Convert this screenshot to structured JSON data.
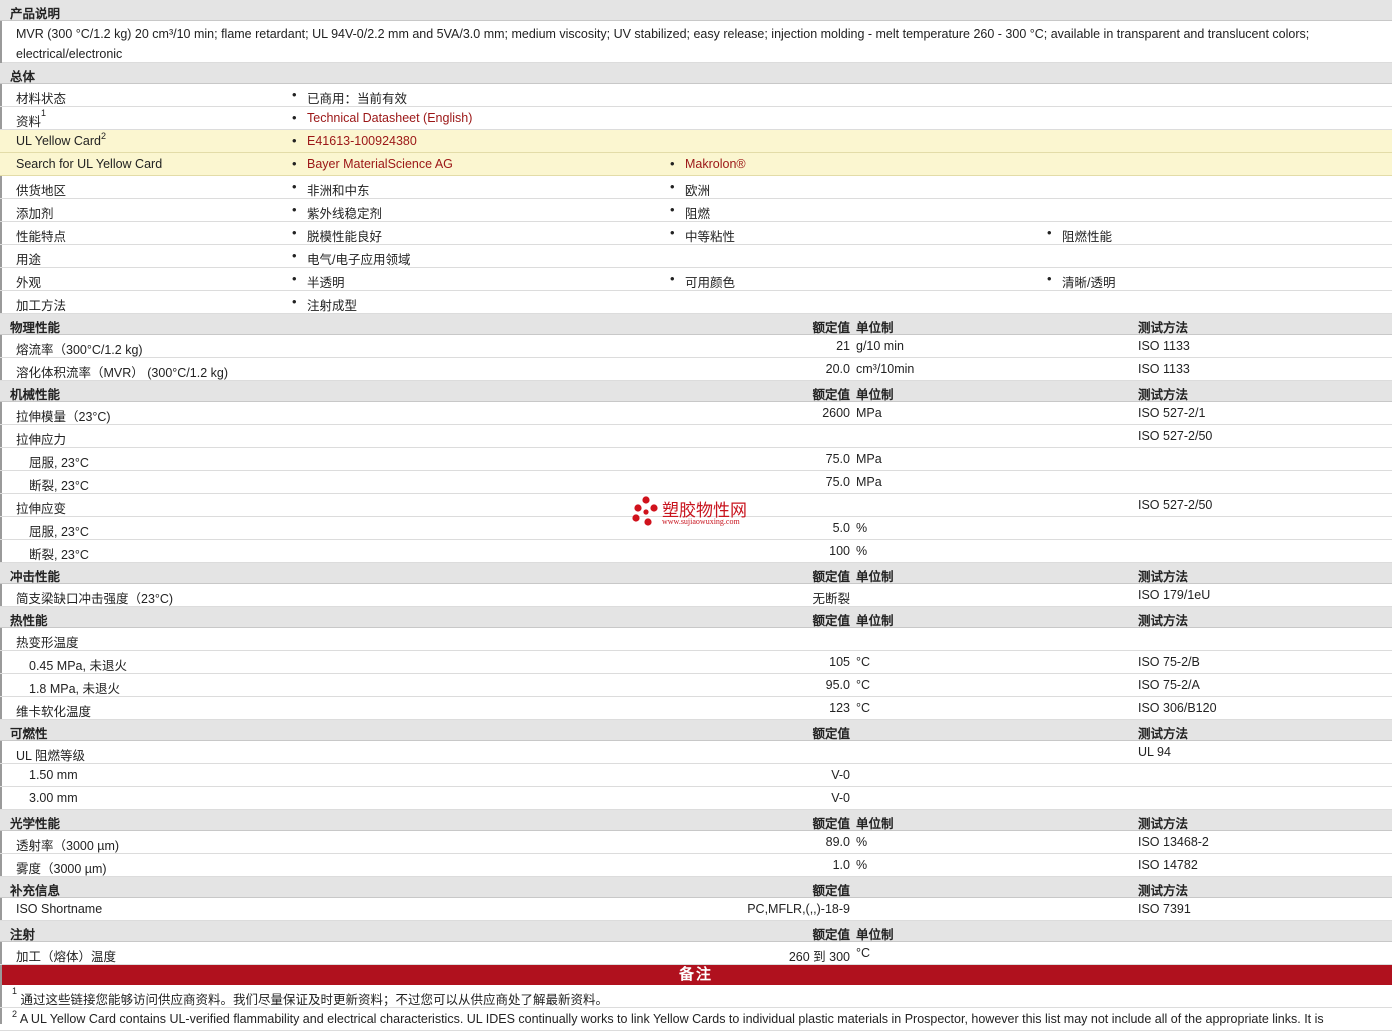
{
  "description": {
    "header": "产品说明",
    "text": "MVR (300 °C/1.2 kg) 20 cm³/10 min; flame retardant; UL 94V-0/2.2 mm and 5VA/3.0 mm; medium viscosity; UV stabilized; easy release; injection molding - melt temperature 260 - 300 °C; available in transparent and translucent colors; electrical/electronic"
  },
  "general": {
    "header": "总体",
    "rows": [
      {
        "label": "材料状态",
        "items": [
          "已商用：当前有效"
        ]
      },
      {
        "label": "资料",
        "sup": "1",
        "items": [
          "Technical Datasheet (English)"
        ],
        "link": true
      },
      {
        "label": "UL Yellow Card",
        "sup": "2",
        "items": [
          "E41613-100924380"
        ],
        "link": true,
        "yellow": true
      },
      {
        "label": "Search for UL Yellow Card",
        "items": [
          "Bayer MaterialScience AG",
          "Makrolon®"
        ],
        "link": true,
        "yellow": true
      },
      {
        "label": "供货地区",
        "items": [
          "非洲和中东",
          "欧洲"
        ]
      },
      {
        "label": "添加剂",
        "items": [
          "紫外线稳定剂",
          "阻燃"
        ]
      },
      {
        "label": "性能特点",
        "items": [
          "脱模性能良好",
          "中等粘性",
          "阻燃性能"
        ]
      },
      {
        "label": "用途",
        "items": [
          "电气/电子应用领域"
        ]
      },
      {
        "label": "外观",
        "items": [
          "半透明",
          "可用颜色",
          "清晰/透明"
        ]
      },
      {
        "label": "加工方法",
        "items": [
          "注射成型"
        ]
      }
    ]
  },
  "cols": {
    "value": "额定值",
    "unit": "单位制",
    "test": "测试方法"
  },
  "sections": [
    {
      "title": "物理性能",
      "unit": true,
      "test": true,
      "rows": [
        {
          "label": "熔流率（300°C/1.2 kg)",
          "value": "21",
          "unit": "g/10 min",
          "test": "ISO 1133"
        },
        {
          "label": "溶化体积流率（MVR） (300°C/1.2 kg)",
          "value": "20.0",
          "unit": "cm³/10min",
          "test": "ISO 1133"
        }
      ]
    },
    {
      "title": "机械性能",
      "unit": true,
      "test": true,
      "rows": [
        {
          "label": "拉伸模量（23°C)",
          "value": "2600",
          "unit": "MPa",
          "test": "ISO 527-2/1"
        },
        {
          "label": "拉伸应力",
          "value": "",
          "unit": "",
          "test": "ISO 527-2/50"
        },
        {
          "label": "屈服, 23°C",
          "sub": true,
          "value": "75.0",
          "unit": "MPa",
          "test": ""
        },
        {
          "label": "断裂, 23°C",
          "sub": true,
          "value": "75.0",
          "unit": "MPa",
          "test": ""
        },
        {
          "label": "拉伸应变",
          "value": "",
          "unit": "",
          "test": "ISO 527-2/50"
        },
        {
          "label": "屈服, 23°C",
          "sub": true,
          "value": "5.0",
          "unit": "%",
          "test": ""
        },
        {
          "label": "断裂, 23°C",
          "sub": true,
          "value": "100",
          "unit": "%",
          "test": ""
        }
      ]
    },
    {
      "title": "冲击性能",
      "unit": true,
      "test": true,
      "rows": [
        {
          "label": "简支梁缺口冲击强度（23°C)",
          "value": "无断裂",
          "unit": "",
          "test": "ISO 179/1eU"
        }
      ]
    },
    {
      "title": "热性能",
      "unit": true,
      "test": true,
      "rows": [
        {
          "label": "热变形温度",
          "value": "",
          "unit": "",
          "test": ""
        },
        {
          "label": "0.45 MPa, 未退火",
          "sub": true,
          "value": "105",
          "unit": "°C",
          "test": "ISO 75-2/B"
        },
        {
          "label": "1.8 MPa, 未退火",
          "sub": true,
          "value": "95.0",
          "unit": "°C",
          "test": "ISO 75-2/A"
        },
        {
          "label": "维卡软化温度",
          "value": "123",
          "unit": "°C",
          "test": "ISO 306/B120"
        }
      ]
    },
    {
      "title": "可燃性",
      "unit": false,
      "test": true,
      "rows": [
        {
          "label": "UL 阻燃等级",
          "value": "",
          "unit": "",
          "test": "UL 94"
        },
        {
          "label": "1.50 mm",
          "sub": true,
          "value": "V-0",
          "unit": "",
          "test": ""
        },
        {
          "label": "3.00 mm",
          "sub": true,
          "value": "V-0",
          "unit": "",
          "test": ""
        }
      ]
    },
    {
      "title": "光学性能",
      "unit": true,
      "test": true,
      "rows": [
        {
          "label": "透射率（3000 µm)",
          "value": "89.0",
          "unit": "%",
          "test": "ISO 13468-2"
        },
        {
          "label": "雾度（3000 µm)",
          "value": "1.0",
          "unit": "%",
          "test": "ISO 14782"
        }
      ]
    },
    {
      "title": "补充信息",
      "unit": false,
      "test": true,
      "rows": [
        {
          "label": "ISO Shortname",
          "value": "PC,MFLR,(,,)-18-9",
          "unit": "",
          "test": "ISO 7391"
        }
      ]
    },
    {
      "title": "注射",
      "unit": true,
      "test": false,
      "rows": [
        {
          "label": "加工（熔体）温度",
          "value": "260 到  300",
          "unit": "°C",
          "test": ""
        }
      ]
    }
  ],
  "notes": {
    "title": "备注",
    "items": [
      {
        "sup": "1",
        "text": "通过这些链接您能够访问供应商资料。我们尽量保证及时更新资料；不过您可以从供应商处了解最新资料。"
      },
      {
        "sup": "2",
        "text": "A UL Yellow Card contains UL-verified flammability and electrical characteristics. UL IDES continually works to link Yellow Cards to individual plastic materials in Prospector, however this list may not include all of the appropriate links. It is"
      }
    ]
  },
  "watermark": {
    "name": "塑胶物性网",
    "url": "www.sujiaowuxing.com"
  }
}
